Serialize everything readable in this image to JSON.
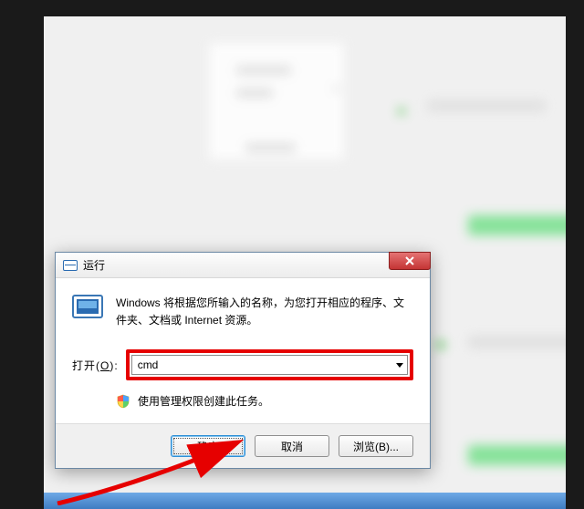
{
  "dialog": {
    "title": "运行",
    "description": "Windows 将根据您所输入的名称，为您打开相应的程序、文件夹、文档或 Internet 资源。",
    "open_label_prefix": "打开(",
    "open_label_hotkey": "O",
    "open_label_suffix": "):",
    "input_value": "cmd",
    "uac_text": "使用管理权限创建此任务。",
    "ok": "确定",
    "cancel": "取消",
    "browse": "浏览(B)..."
  }
}
